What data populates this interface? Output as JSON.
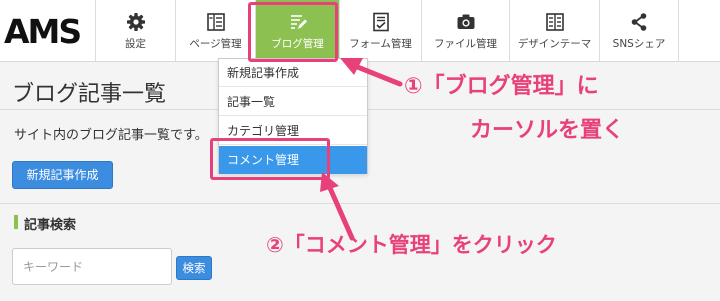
{
  "logo": "AMS",
  "toolbar": {
    "items": [
      {
        "label": "設定",
        "icon": "gear-icon"
      },
      {
        "label": "ページ管理",
        "icon": "page-layout-icon"
      },
      {
        "label": "ブログ管理",
        "icon": "blog-pen-icon",
        "active": true
      },
      {
        "label": "フォーム管理",
        "icon": "form-checklist-icon"
      },
      {
        "label": "ファイル管理",
        "icon": "camera-icon"
      },
      {
        "label": "デザインテーマ",
        "icon": "design-theme-icon"
      },
      {
        "label": "SNSシェア",
        "icon": "share-icon"
      }
    ],
    "active_color": "#8cc152"
  },
  "dropdown": {
    "items": [
      {
        "label": "新規記事作成"
      },
      {
        "label": "記事一覧"
      },
      {
        "label": "カテゴリ管理"
      },
      {
        "label": "コメント管理",
        "highlighted": true
      }
    ],
    "highlight_color": "#3a98ea"
  },
  "main": {
    "title": "ブログ記事一覧",
    "description": "サイト内のブログ記事一覧です。",
    "new_button": "新規記事作成",
    "search_section": "記事検索",
    "keyword_placeholder": "キーワード",
    "search_button": "検索"
  },
  "annotations": {
    "step1_line1": "①「ブログ管理」に",
    "step1_line2": "カーソルを置く",
    "step2": "②「コメント管理」をクリック",
    "color": "#e8407a"
  }
}
